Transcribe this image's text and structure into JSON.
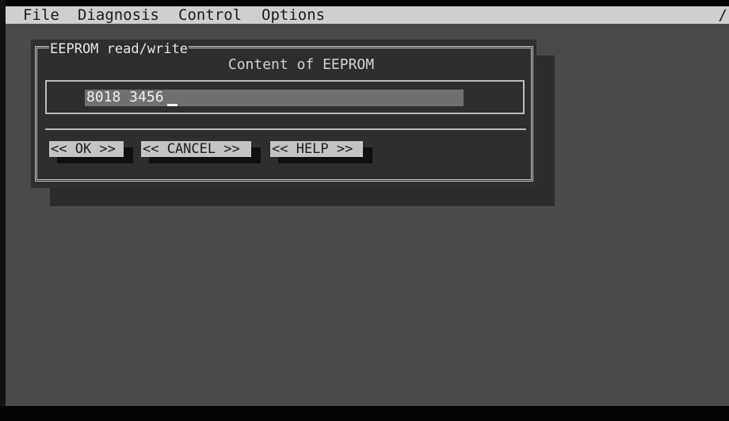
{
  "menubar": {
    "items": [
      "File",
      "Diagnosis",
      "Control",
      "Options"
    ],
    "corner": "/"
  },
  "dialog": {
    "title": "EEPROM read/write",
    "content_label": "Content of EEPROM",
    "input": {
      "value": "8018 3456"
    },
    "buttons": {
      "ok": "<< OK >>",
      "cancel": "<< CANCEL >>",
      "help": "<< HELP >>"
    }
  },
  "colors": {
    "menubar": "#cfcfcf",
    "desktop": "#4a4a4a",
    "dialog": "#2e2e2e",
    "button": "#c4c4c4",
    "input_field": "#707070"
  }
}
